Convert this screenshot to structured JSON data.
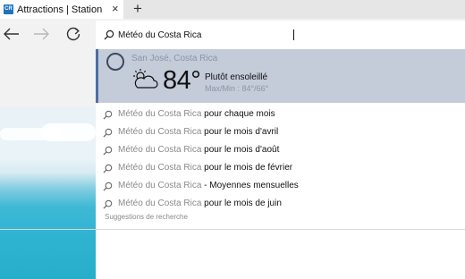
{
  "tab": {
    "favicon_text": "CR",
    "title": "Attractions | Station",
    "close_glyph": "×",
    "new_tab_glyph": "+"
  },
  "nav": {
    "back_icon": "back-arrow-icon",
    "forward_icon": "forward-arrow-icon",
    "refresh_icon": "refresh-icon"
  },
  "address": {
    "value": "Météo du Costa Rica"
  },
  "weather": {
    "city": "San José, Costa Rica",
    "temperature": "84°",
    "condition": "Plutôt ensoleillé",
    "minmax": "Max/Min : 84°/66°"
  },
  "suggestions": [
    {
      "prefix": "Météo du Costa Rica",
      "suffix": " pour chaque mois"
    },
    {
      "prefix": "Météo du Costa Rica",
      "suffix": " pour le mois d'avril"
    },
    {
      "prefix": "Météo du Costa Rica",
      "suffix": " pour le mois d'août"
    },
    {
      "prefix": "Météo du Costa Rica",
      "suffix": " pour le mois de février"
    },
    {
      "prefix": "Météo du Costa Rica",
      "suffix": " - Moyennes mensuelles"
    },
    {
      "prefix": "Météo du Costa Rica",
      "suffix": " pour le mois de juin"
    }
  ],
  "suggestions_footer": "Suggestions de recherche",
  "colors": {
    "accent": "#4a6fa5",
    "weather_bg": "#c4cbd9",
    "tab_bar_bg": "#e6e6e6",
    "nav_bg": "#f2f2f2"
  }
}
